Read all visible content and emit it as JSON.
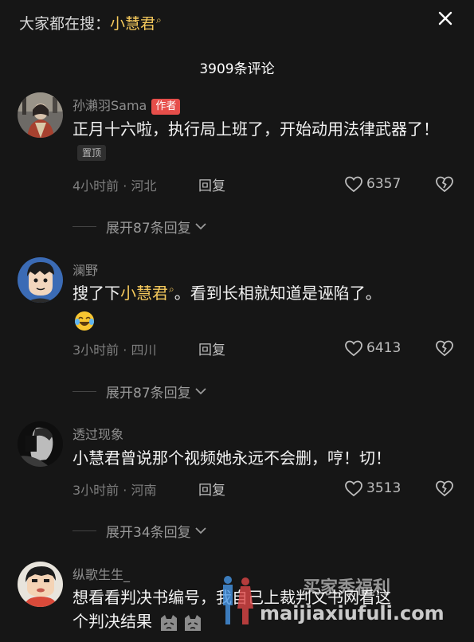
{
  "header": {
    "search_prefix": "大家都在搜：",
    "search_term": "小慧君",
    "comment_count_title": "3909条评论"
  },
  "comments": [
    {
      "username": "孙瀨羽Sama",
      "author_badge": "作者",
      "text": "正月十六啦，执行局上班了，开始动用法律武器了！",
      "pin_badge": "置顶",
      "meta": "4小时前 · 河北",
      "reply_label": "回复",
      "likes": "6357",
      "expand_label": "展开87条回复"
    },
    {
      "username": "澜野",
      "text_before": "搜了下",
      "mention": "小慧君",
      "text_after": "。看到长相就知道是诬陷了。",
      "emoji": "crying-laughing-emoji",
      "meta": "3小时前 · 四川",
      "reply_label": "回复",
      "likes": "6413",
      "expand_label": "展开87条回复"
    },
    {
      "username": "透过现象",
      "text": "小慧君曾说那个视频她永远不会删，哼！切！",
      "meta": "3小时前 · 河南",
      "reply_label": "回复",
      "likes": "3513",
      "expand_label": "展开34条回复"
    },
    {
      "username": "纵歌生生_",
      "text_line1": "想看看判决书编号，我自己上裁判文书网看这",
      "text_line2": "个判决结果",
      "emoji": "cat-emoji"
    }
  ],
  "watermark": {
    "title": "买家秀福利",
    "url": "maijiaxiufuli.com"
  },
  "colors": {
    "background": "#161616",
    "accent_yellow": "#f5c95c",
    "author_badge_red": "#e64e4a"
  }
}
